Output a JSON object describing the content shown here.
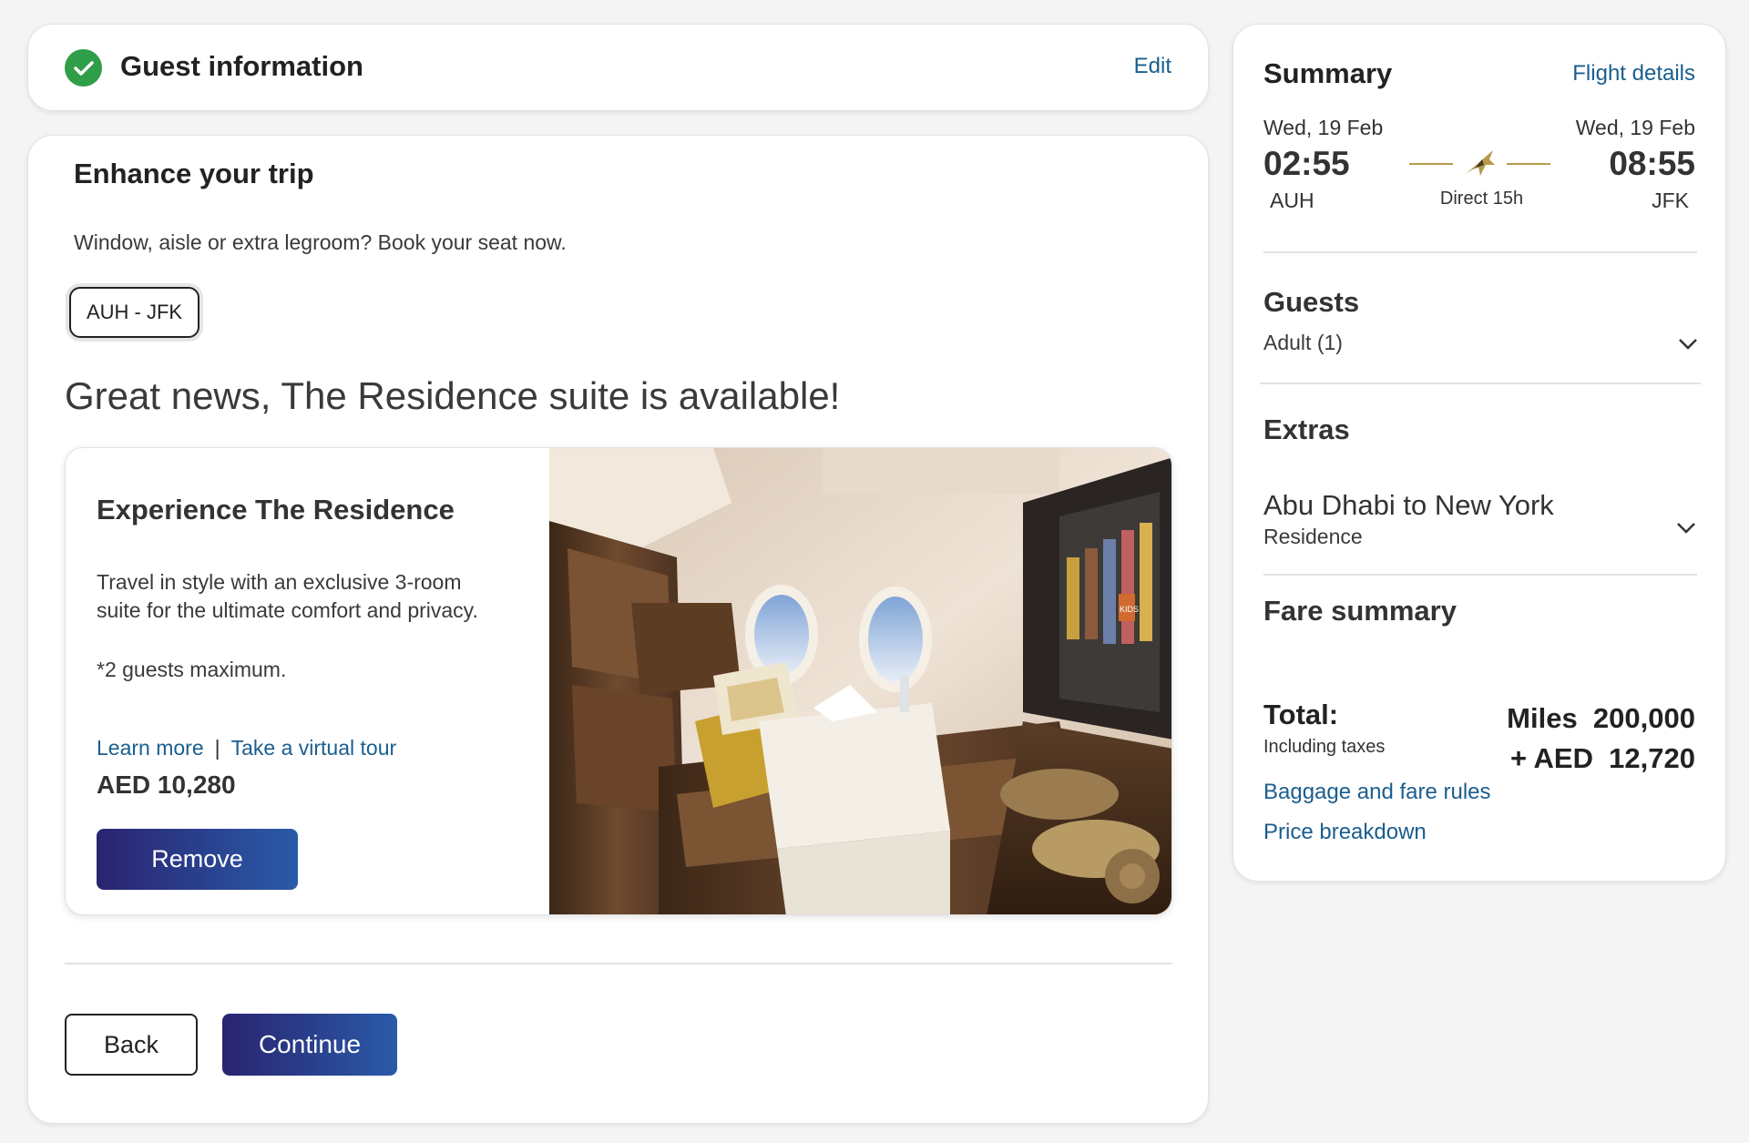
{
  "guest": {
    "title": "Guest information",
    "edit_label": "Edit"
  },
  "enhance": {
    "title": "Enhance your trip",
    "subtitle": "Window, aisle or extra legroom? Book your seat now.",
    "route_tab": "AUH - JFK",
    "headline": "Great news, The Residence suite is available!",
    "offer": {
      "title": "Experience The Residence",
      "description": "Travel in style with an exclusive 3-room suite for the ultimate comfort and privacy.",
      "note": "*2 guests maximum.",
      "learn_more": "Learn more",
      "separator": "|",
      "virtual_tour": "Take a virtual tour",
      "price": "AED 10,280",
      "remove_label": "Remove",
      "tv_badge": "KIDS"
    },
    "back_label": "Back",
    "continue_label": "Continue"
  },
  "summary": {
    "title": "Summary",
    "flight_details": "Flight details",
    "departure": {
      "date": "Wed, 19 Feb",
      "time": "02:55",
      "code": "AUH"
    },
    "arrival": {
      "date": "Wed, 19 Feb",
      "time": "08:55",
      "code": "JFK"
    },
    "duration": "Direct 15h",
    "guests_title": "Guests",
    "guests_value": "Adult (1)",
    "extras_title": "Extras",
    "extras_route": "Abu Dhabi to New York",
    "extras_item": "Residence",
    "fare_title": "Fare summary",
    "total_label": "Total:",
    "total_sub": "Including taxes",
    "total_miles": "Miles  200,000",
    "total_aed": "+ AED  12,720",
    "baggage_link": "Baggage and fare rules",
    "price_link": "Price breakdown"
  },
  "colors": {
    "accent_link": "#1a5e8f",
    "button_gradient_start": "#2a2470",
    "button_gradient_end": "#2a5aa8",
    "success": "#2e9e48",
    "gold": "#b89a4a"
  },
  "icons": {
    "check": "check-circle-icon",
    "plane": "plane-icon",
    "chevron": "chevron-down-icon"
  }
}
